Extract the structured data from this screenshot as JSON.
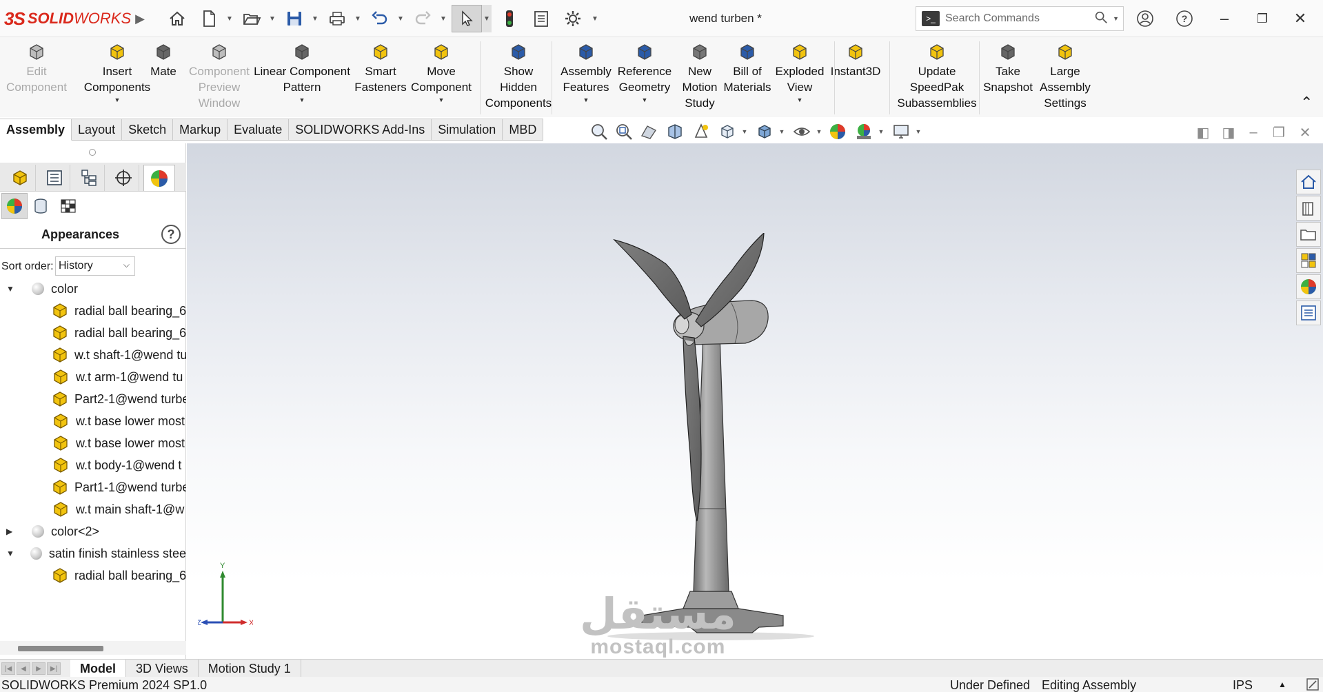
{
  "app": {
    "logo_mark": "3S",
    "logo_text_1": "SOLID",
    "logo_text_2": "WORKS",
    "document_title": "wend turben *"
  },
  "search": {
    "placeholder": "Search Commands"
  },
  "ribbon": {
    "commands": [
      {
        "line1": "Edit",
        "line2": "Component",
        "line3": "",
        "icon": "edit-component-icon",
        "enabled": false
      },
      {
        "line1": "Insert",
        "line2": "Components",
        "line3": "",
        "icon": "insert-components-icon",
        "enabled": true
      },
      {
        "line1": "Mate",
        "line2": "",
        "line3": "",
        "icon": "mate-icon",
        "enabled": true
      },
      {
        "line1": "Component",
        "line2": "Preview",
        "line3": "Window",
        "icon": "component-preview-icon",
        "enabled": false
      },
      {
        "line1": "Linear Component",
        "line2": "Pattern",
        "line3": "",
        "icon": "linear-pattern-icon",
        "enabled": true
      },
      {
        "line1": "Smart",
        "line2": "Fasteners",
        "line3": "",
        "icon": "smart-fasteners-icon",
        "enabled": true
      },
      {
        "line1": "Move",
        "line2": "Component",
        "line3": "",
        "icon": "move-component-icon",
        "enabled": true
      },
      {
        "line1": "Show",
        "line2": "Hidden",
        "line3": "Components",
        "icon": "show-hidden-icon",
        "enabled": true
      },
      {
        "line1": "Assembly",
        "line2": "Features",
        "line3": "",
        "icon": "assembly-features-icon",
        "enabled": true
      },
      {
        "line1": "Reference",
        "line2": "Geometry",
        "line3": "",
        "icon": "reference-geometry-icon",
        "enabled": true
      },
      {
        "line1": "New",
        "line2": "Motion",
        "line3": "Study",
        "icon": "motion-study-icon",
        "enabled": true
      },
      {
        "line1": "Bill of",
        "line2": "Materials",
        "line3": "",
        "icon": "bill-of-materials-icon",
        "enabled": true
      },
      {
        "line1": "Exploded",
        "line2": "View",
        "line3": "",
        "icon": "exploded-view-icon",
        "enabled": true
      },
      {
        "line1": "Instant3D",
        "line2": "",
        "line3": "",
        "icon": "instant3d-icon",
        "enabled": true
      },
      {
        "line1": "Update",
        "line2": "SpeedPak",
        "line3": "Subassemblies",
        "icon": "speedpak-icon",
        "enabled": true
      },
      {
        "line1": "Take",
        "line2": "Snapshot",
        "line3": "",
        "icon": "snapshot-icon",
        "enabled": true
      },
      {
        "line1": "Large",
        "line2": "Assembly",
        "line3": "Settings",
        "icon": "large-assembly-icon",
        "enabled": true
      }
    ]
  },
  "tabs": [
    "Assembly",
    "Layout",
    "Sketch",
    "Markup",
    "Evaluate",
    "SOLIDWORKS Add-Ins",
    "Simulation",
    "MBD"
  ],
  "panel": {
    "title": "Appearances",
    "sort_label": "Sort order:",
    "sort_value": "History",
    "tree": [
      {
        "label": "color",
        "kind": "appearance",
        "expanded": true
      },
      {
        "label": "radial ball bearing_6",
        "kind": "part"
      },
      {
        "label": "radial ball bearing_6",
        "kind": "part"
      },
      {
        "label": "w.t shaft-1@wend tu",
        "kind": "part"
      },
      {
        "label": "w.t arm-1@wend tu",
        "kind": "part"
      },
      {
        "label": "Part2-1@wend turbe",
        "kind": "part"
      },
      {
        "label": "w.t base lower most",
        "kind": "part"
      },
      {
        "label": "w.t base lower most",
        "kind": "part"
      },
      {
        "label": "w.t body-1@wend t",
        "kind": "part"
      },
      {
        "label": "Part1-1@wend turbe",
        "kind": "part"
      },
      {
        "label": "w.t main shaft-1@w",
        "kind": "part"
      },
      {
        "label": "color<2>",
        "kind": "appearance",
        "expanded": false
      },
      {
        "label": "satin finish stainless stee",
        "kind": "appearance",
        "expanded": true
      },
      {
        "label": "radial ball bearing_6",
        "kind": "part"
      }
    ]
  },
  "triad": {
    "x": "X",
    "y": "Y",
    "z": "Z"
  },
  "watermark": {
    "arabic": "مستقل",
    "latin": "mostaql.com"
  },
  "bottom_tabs": [
    "Model",
    "3D Views",
    "Motion Study 1"
  ],
  "status": {
    "product": "SOLIDWORKS Premium 2024 SP1.0",
    "definition": "Under Defined",
    "mode": "Editing Assembly",
    "units": "IPS"
  },
  "colors": {
    "brand": "#da291c",
    "part_icon": "#f2c40f",
    "model_gray": "#9a9a9a"
  }
}
